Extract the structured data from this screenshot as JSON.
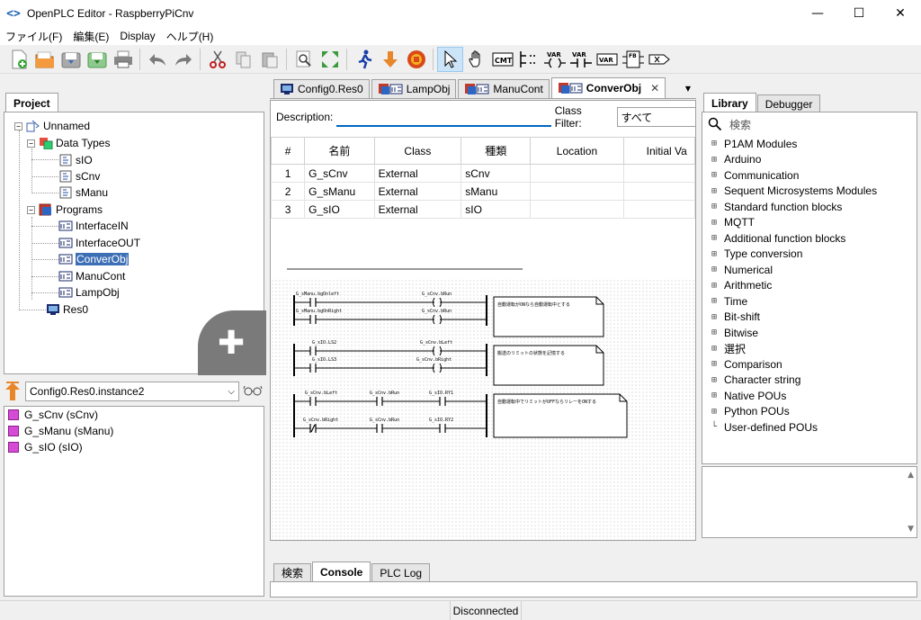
{
  "window": {
    "title": "OpenPLC Editor - RaspberryPiCnv",
    "icon": "<>",
    "minimize": "—",
    "maximize": "☐",
    "close": "✕"
  },
  "menu": [
    "ファイル(F)",
    "編集(E)",
    "Display",
    "ヘルプ(H)"
  ],
  "left_tabs": {
    "project": "Project"
  },
  "project_tree": {
    "root": "Unnamed",
    "data_types_label": "Data Types",
    "data_types": [
      "sIO",
      "sCnv",
      "sManu"
    ],
    "programs_label": "Programs",
    "programs": [
      "InterfaceIN",
      "InterfaceOUT",
      "ConverObj",
      "ManuCont",
      "LampObj"
    ],
    "selected": "ConverObj",
    "resource": "Res0"
  },
  "add_button_icon": "✚",
  "instance": {
    "value": "Config0.Res0.instance2",
    "debug_icon": "glasses-icon"
  },
  "instance_vars": [
    "G_sCnv (sCnv)",
    "G_sManu (sManu)",
    "G_sIO (sIO)"
  ],
  "editor_tabs": [
    {
      "label": "Config0.Res0",
      "icon": "config-icon"
    },
    {
      "label": "LampObj",
      "icon": "pou-icon"
    },
    {
      "label": "ManuCont",
      "icon": "pou-icon"
    },
    {
      "label": "ConverObj",
      "icon": "pou-icon",
      "active": true
    }
  ],
  "editor": {
    "description_label": "Description:",
    "description_value": "",
    "class_filter_label": "Class Filter:",
    "class_filter_value": "すべて",
    "columns": [
      "#",
      "名前",
      "Class",
      "種類",
      "Location",
      "Initial Va"
    ],
    "rows": [
      [
        "1",
        "G_sCnv",
        "External",
        "sCnv",
        "",
        ""
      ],
      [
        "2",
        "G_sManu",
        "External",
        "sManu",
        "",
        ""
      ],
      [
        "3",
        "G_sIO",
        "External",
        "sIO",
        "",
        ""
      ]
    ]
  },
  "ladder": {
    "rung1": {
      "contact_a": "G_sManu.bgOnleft",
      "contact_b": "G_sManu.bgOnRight",
      "coil_a": "G_sCnv.bRun",
      "coil_b": "G_sCnv.bRun",
      "comment": "自動運転がONなら自動運転中とする"
    },
    "rung2": {
      "contact_a": "G_sIO.LS2",
      "contact_b": "G_sIO.LS3",
      "coil_a": "G_sCnv.bLeft",
      "coil_b": "G_sCnv.bRight",
      "comment": "搬送のリミットの状態を記憶する"
    },
    "rung3": {
      "c1": "G_sCnv.bLeft",
      "c2": "G_sCnv.bRun",
      "c3": "G_sIO.RY1",
      "c4": "G_sCnv.bRight",
      "c5": "G_sCnv.bRun",
      "c6": "G_sIO.RY2",
      "comment": "自動運転中でリミットがOFFならリレーをONする"
    }
  },
  "bottom_tabs": [
    "検索",
    "Console",
    "PLC Log"
  ],
  "active_bottom_tab": "Console",
  "library_tabs": [
    "Library",
    "Debugger"
  ],
  "library_search_placeholder": "検索",
  "library_items": [
    "P1AM Modules",
    "Arduino",
    "Communication",
    "Sequent Microsystems Modules",
    "Standard function blocks",
    "MQTT",
    "Additional function blocks",
    "Type conversion",
    "Numerical",
    "Arithmetic",
    "Time",
    "Bit-shift",
    "Bitwise",
    "選択",
    "Comparison",
    "Character string",
    "Native POUs",
    "Python POUs",
    "User-defined POUs"
  ],
  "status": "Disconnected",
  "toolbar_icons": [
    "new-file-icon",
    "open-folder-icon",
    "save-icon",
    "save-as-icon",
    "print-icon",
    "undo-icon",
    "redo-icon",
    "cut-icon",
    "copy-icon",
    "paste-icon",
    "find-icon",
    "fullscreen-icon",
    "run-icon",
    "download-icon",
    "stop-icon",
    "pointer-icon",
    "hand-icon",
    "comment-icon",
    "power-rail-icon",
    "variable-icon",
    "contact-icon",
    "var-block-icon",
    "function-block-icon",
    "connection-icon"
  ],
  "toolbar_text": {
    "cmt": "CMT",
    "var": "VAR",
    "fb": "FB"
  }
}
